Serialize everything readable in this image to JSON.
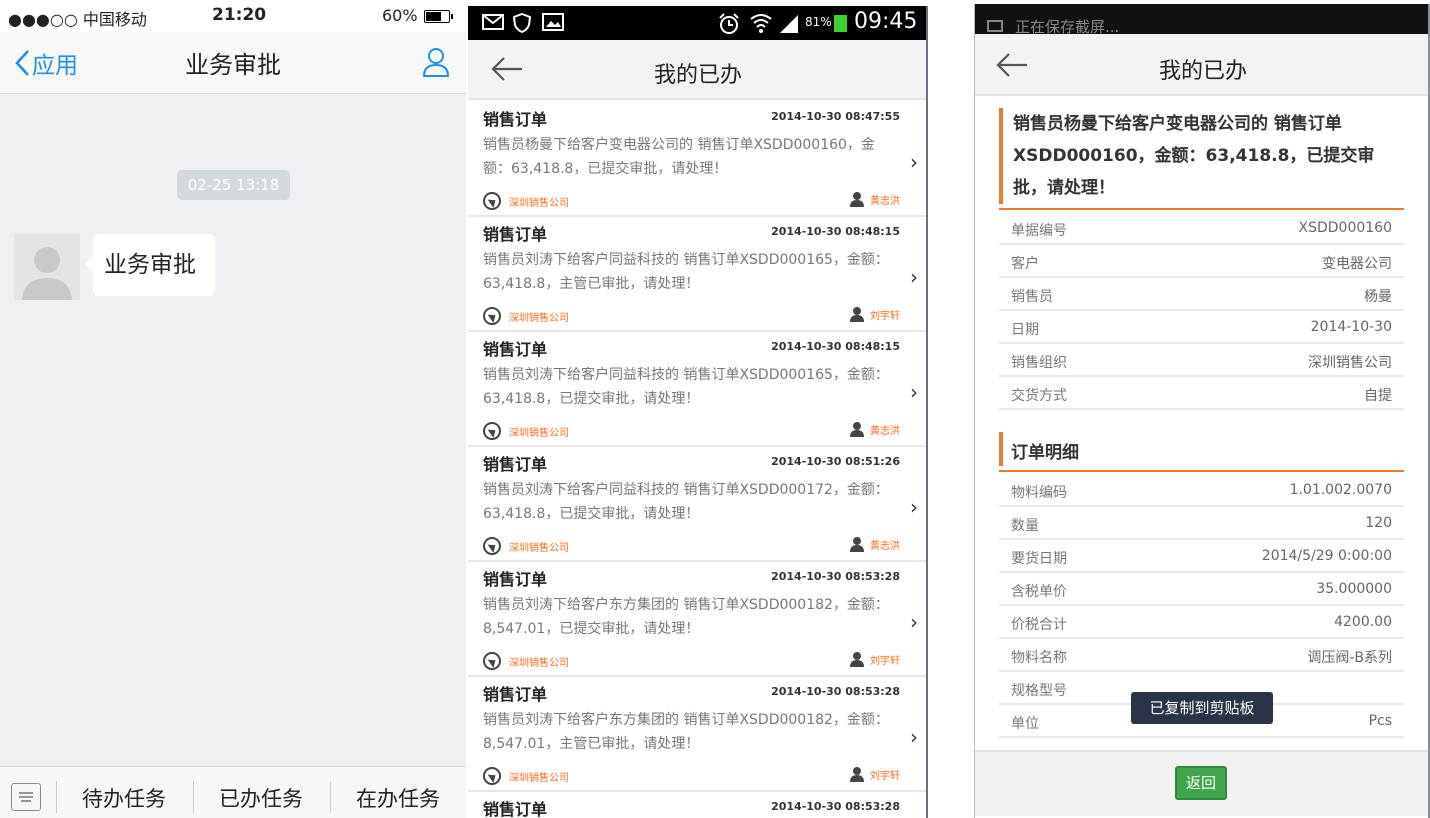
{
  "ios": {
    "status": {
      "signal": "●●●○○ 中国移动",
      "time": "21:20",
      "battery": "60%"
    },
    "nav": {
      "back_label": "应用",
      "title": "业务审批"
    },
    "timestamp": "02-25 13:18",
    "message": "业务审批",
    "tabs": [
      "待办任务",
      "已办任务",
      "在办任务"
    ]
  },
  "android_list": {
    "status": {
      "battery_pct": "81%",
      "time": "09:45"
    },
    "title": "我的已办",
    "items": [
      {
        "title": "销售订单",
        "date": "2014-10-30 08:47:55",
        "desc": "销售员杨曼下给客户变电器公司的 销售订单XSDD000160，金额：63,418.8，已提交审批，请处理！",
        "org": "深圳销售公司",
        "user": "黄志洪"
      },
      {
        "title": "销售订单",
        "date": "2014-10-30 08:48:15",
        "desc": "销售员刘涛下给客户同益科技的 销售订单XSDD000165，金额：63,418.8，主管已审批，请处理！",
        "org": "深圳销售公司",
        "user": "刘宇轩"
      },
      {
        "title": "销售订单",
        "date": "2014-10-30 08:48:15",
        "desc": "销售员刘涛下给客户同益科技的 销售订单XSDD000165，金额：63,418.8，已提交审批，请处理！",
        "org": "深圳销售公司",
        "user": "黄志洪"
      },
      {
        "title": "销售订单",
        "date": "2014-10-30 08:51:26",
        "desc": "销售员刘涛下给客户同益科技的 销售订单XSDD000172，金额：63,418.8，已提交审批，请处理！",
        "org": "深圳销售公司",
        "user": "黄志洪"
      },
      {
        "title": "销售订单",
        "date": "2014-10-30 08:53:28",
        "desc": "销售员刘涛下给客户东方集团的 销售订单XSDD000182，金额：8,547.01，已提交审批，请处理！",
        "org": "深圳销售公司",
        "user": "刘宇轩"
      },
      {
        "title": "销售订单",
        "date": "2014-10-30 08:53:28",
        "desc": "销售员刘涛下给客户东方集团的 销售订单XSDD000182，金额：8,547.01，主管已审批，请处理！",
        "org": "深圳销售公司",
        "user": "刘宇轩"
      }
    ],
    "partial_item": {
      "title": "销售订单",
      "date": "2014-10-30 08:53:28"
    }
  },
  "detail": {
    "status_text": "正在保存截屏...",
    "title": "我的已办",
    "summary": "销售员杨曼下给客户变电器公司的 销售订单XSDD000160，金额：63,418.8，已提交审批，请处理！",
    "fields": [
      {
        "k": "单据编号",
        "v": "XSDD000160"
      },
      {
        "k": "客户",
        "v": "变电器公司"
      },
      {
        "k": "销售员",
        "v": "杨曼"
      },
      {
        "k": "日期",
        "v": "2014-10-30"
      },
      {
        "k": "销售组织",
        "v": "深圳销售公司"
      },
      {
        "k": "交货方式",
        "v": "自提"
      }
    ],
    "section_title": "订单明细",
    "items": [
      {
        "k": "物料编码",
        "v": "1.01.002.0070"
      },
      {
        "k": "数量",
        "v": "120"
      },
      {
        "k": "要货日期",
        "v": "2014/5/29 0:00:00"
      },
      {
        "k": "含税单价",
        "v": "35.000000"
      },
      {
        "k": "价税合计",
        "v": "4200.00"
      },
      {
        "k": "物料名称",
        "v": "调压阀-B系列"
      },
      {
        "k": "规格型号",
        "v": ""
      },
      {
        "k": "单位",
        "v": "Pcs"
      }
    ],
    "toast": "已复制到剪贴板",
    "back_button": "返回"
  },
  "colors": {
    "ios_blue": "#1e8cf0",
    "accent_orange": "#f07a2a",
    "button_green": "#3da84a"
  }
}
